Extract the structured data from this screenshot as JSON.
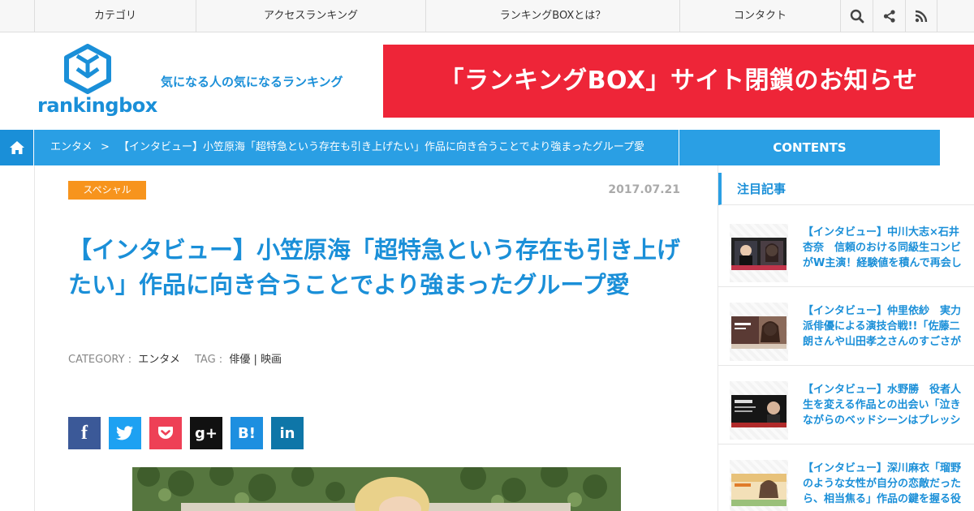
{
  "nav": {
    "items": [
      "カテゴリ",
      "アクセスランキング",
      "ランキングBOXとは？",
      "コンタクト"
    ],
    "icons": [
      "search-icon",
      "share-icon",
      "rss-icon"
    ]
  },
  "header": {
    "logo_text": "rankingbox",
    "tagline": "気になる人の気になるランキング",
    "banner": "「ランキングBOX」サイト閉鎖のお知らせ"
  },
  "breadcrumb": {
    "category": "エンタメ",
    "separator": ">",
    "current": "【インタビュー】小笠原海「超特急という存在も引き上げたい」作品に向き合うことでより強まったグループ愛",
    "contents_label": "CONTENTS"
  },
  "article": {
    "badge": "スペシャル",
    "date": "2017.07.21",
    "title": "【インタビュー】小笠原海「超特急という存在も引き上げたい」作品に向き合うことでより強まったグループ愛",
    "category_label": "CATEGORY :",
    "category_value": "エンタメ",
    "tag_label": "TAG :",
    "tag_value": "俳優 | 映画"
  },
  "share": {
    "facebook": "f",
    "twitter": "twitter-icon",
    "pocket": "pocket-icon",
    "googleplus": "g+",
    "hatena": "B!",
    "linkedin": "in"
  },
  "sidebar": {
    "heading": "注目記事",
    "items": [
      {
        "text": "【インタビュー】中川大志×石井杏奈　信頼のおける同級生コンビがW主演！経験値を積んで再会し"
      },
      {
        "text": "【インタビュー】仲里依紗　実力派俳優による演技合戦!!「佐藤二朗さんや山田孝之さんのすごさが"
      },
      {
        "text": "【インタビュー】水野勝　役者人生を変える作品との出会い「泣きながらのベッドシーンはプレッシ"
      },
      {
        "text": "【インタビュー】深川麻衣「瑠野のような女性が自分の恋敵だったら、相当焦る」作品の鍵を握る役"
      }
    ]
  },
  "colors": {
    "brand_blue": "#1a8fd8",
    "bar_blue": "#2a9fe4",
    "banner_red": "#ee2538",
    "badge_orange": "#f7941d",
    "facebook": "#3b5998",
    "twitter": "#1da1f2",
    "pocket": "#ee4056",
    "googleplus": "#111111",
    "hatena": "#1d8fe0",
    "linkedin": "#0e76a8"
  }
}
